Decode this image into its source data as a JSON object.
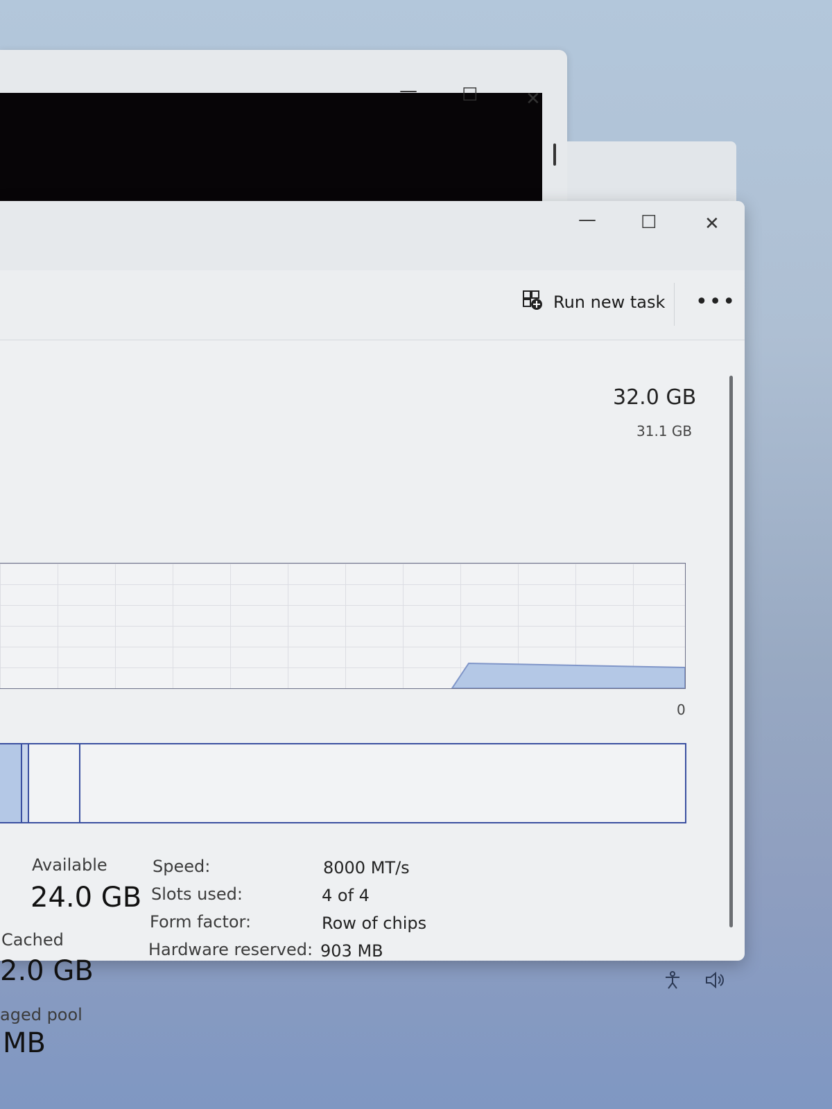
{
  "back_window": {
    "minimize_glyph": "—",
    "maximize_glyph": "☐",
    "close_glyph": "✕"
  },
  "main_window": {
    "minimize_glyph": "—",
    "maximize_glyph": "☐",
    "close_glyph": "✕",
    "toolbar": {
      "run_new_task_label": "Run new task",
      "run_new_task_icon": "run-task-icon",
      "more_label": "•••"
    },
    "memory": {
      "total": "32.0 GB",
      "graph_max": "31.1 GB",
      "graph_min": "0",
      "usage_fraction_recent": 0.2
    },
    "stats": {
      "available_label": "Available",
      "available_value": "24.0 GB",
      "cached_label": "Cached",
      "cached_value": "2.0 GB",
      "paged_pool_label": "aged pool",
      "paged_pool_value": "MB"
    },
    "details": [
      {
        "label": "Speed:",
        "value": "8000 MT/s"
      },
      {
        "label": "Slots used:",
        "value": "4 of 4"
      },
      {
        "label": "Form factor:",
        "value": "Row of chips"
      },
      {
        "label": "Hardware reserved:",
        "value": "903 MB"
      }
    ]
  },
  "taskbar": {
    "accessibility_icon": "accessibility-icon",
    "volume_icon": "volume-icon"
  },
  "colors": {
    "graph_fill": "#b4c8e6",
    "graph_line": "#7f95c8",
    "composition_border": "#3a4fa0"
  }
}
